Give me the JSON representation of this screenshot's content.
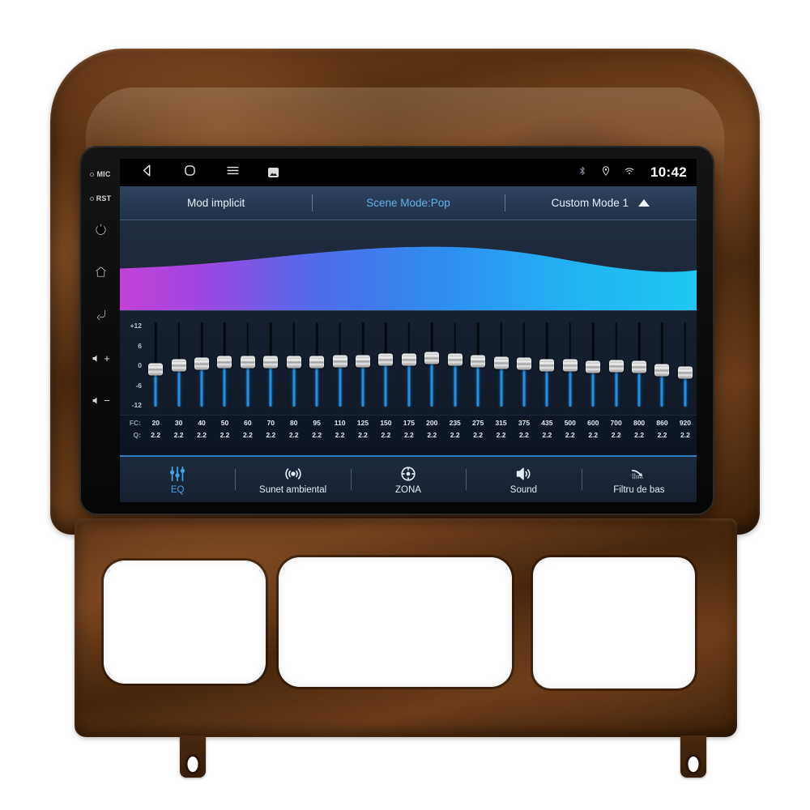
{
  "statusbar": {
    "nav_icons": [
      "back-icon",
      "home-icon",
      "menu-icon",
      "screenshot-icon"
    ],
    "indicators": [
      "bluetooth-icon",
      "location-icon",
      "wifi-icon"
    ],
    "clock": "10:42"
  },
  "hardware_buttons": {
    "mic_label": "MIC",
    "reset_label": "RST",
    "buttons": [
      "power-icon",
      "home-icon",
      "back-icon",
      "volume-up-icon",
      "volume-down-icon"
    ],
    "volume_up": "+",
    "volume_down": "−"
  },
  "mode_header": {
    "default_mode": "Mod implicit",
    "scene_mode": "Scene Mode:Pop",
    "custom_mode": "Custom Mode 1",
    "expand_icon": "triangle-up-icon",
    "accent_color": "#5fb4ef"
  },
  "curve": {
    "gradient_start": "#c442d8",
    "gradient_mid": "#3c6ef0",
    "gradient_end": "#1fc8f0",
    "background": "#202c3f"
  },
  "equalizer": {
    "scale_labels": [
      "+12",
      "6",
      "0",
      "-6",
      "-12"
    ],
    "scale_max": 12,
    "scale_min": -12,
    "fc_label": "FC:",
    "q_label": "Q:",
    "track_color": "#1f90e8",
    "bands": [
      {
        "fc": "20",
        "q": "2.2",
        "gain": -1.2
      },
      {
        "fc": "30",
        "q": "2.2",
        "gain": 0.0
      },
      {
        "fc": "40",
        "q": "2.2",
        "gain": 0.6
      },
      {
        "fc": "50",
        "q": "2.2",
        "gain": 1.0
      },
      {
        "fc": "60",
        "q": "2.2",
        "gain": 1.0
      },
      {
        "fc": "70",
        "q": "2.2",
        "gain": 1.1
      },
      {
        "fc": "80",
        "q": "2.2",
        "gain": 1.0
      },
      {
        "fc": "95",
        "q": "2.2",
        "gain": 1.1
      },
      {
        "fc": "110",
        "q": "2.2",
        "gain": 1.2
      },
      {
        "fc": "125",
        "q": "2.2",
        "gain": 1.3
      },
      {
        "fc": "150",
        "q": "2.2",
        "gain": 1.6
      },
      {
        "fc": "175",
        "q": "2.2",
        "gain": 1.8
      },
      {
        "fc": "200",
        "q": "2.2",
        "gain": 2.1
      },
      {
        "fc": "235",
        "q": "2.2",
        "gain": 1.8
      },
      {
        "fc": "275",
        "q": "2.2",
        "gain": 1.3
      },
      {
        "fc": "315",
        "q": "2.2",
        "gain": 0.7
      },
      {
        "fc": "375",
        "q": "2.2",
        "gain": 0.4
      },
      {
        "fc": "435",
        "q": "2.2",
        "gain": 0.0
      },
      {
        "fc": "500",
        "q": "2.2",
        "gain": -0.1
      },
      {
        "fc": "600",
        "q": "2.2",
        "gain": -0.4
      },
      {
        "fc": "700",
        "q": "2.2",
        "gain": -0.2
      },
      {
        "fc": "800",
        "q": "2.2",
        "gain": -0.6
      },
      {
        "fc": "860",
        "q": "2.2",
        "gain": -1.5
      },
      {
        "fc": "920",
        "q": "2.2",
        "gain": -2.2
      }
    ]
  },
  "bottom_nav": {
    "active_index": 0,
    "items": [
      {
        "label": "EQ",
        "icon": "equalizer-icon"
      },
      {
        "label": "Sunet ambiental",
        "icon": "surround-sound-icon"
      },
      {
        "label": "ZONA",
        "icon": "zone-target-icon"
      },
      {
        "label": "Sound",
        "icon": "speaker-icon"
      },
      {
        "label": "Filtru de bas",
        "icon": "bass-filter-icon"
      }
    ]
  }
}
